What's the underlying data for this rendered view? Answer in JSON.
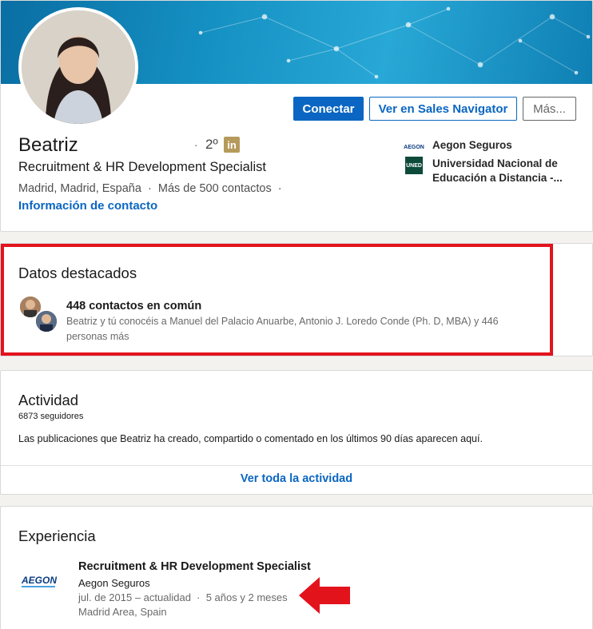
{
  "profile": {
    "name": "Beatriz",
    "separator": "·",
    "degree": "2º",
    "linkedin_badge": "in",
    "headline": "Recruitment & HR Development Specialist",
    "location_line": "Madrid, Madrid, España  ·  Más de 500 contactos  ·",
    "contact_info_link": "Información de contacto"
  },
  "actions": {
    "connect": "Conectar",
    "sales_navigator": "Ver en Sales Navigator",
    "more": "Más..."
  },
  "organizations": [
    {
      "name": "Aegon Seguros",
      "logo_text": "AEGON"
    },
    {
      "name": "Universidad Nacional de Educación a Distancia -...",
      "logo_text": "UNED"
    }
  ],
  "highlights": {
    "title": "Datos destacados",
    "mutual_title": "448 contactos en común",
    "mutual_desc": "Beatriz y tú conocéis a Manuel del Palacio Anuarbe, Antonio J. Loredo Conde (Ph. D, MBA) y 446 personas más"
  },
  "activity": {
    "title": "Actividad",
    "followers": "6873 seguidores",
    "description": "Las publicaciones que Beatriz ha creado, compartido o comentado en los últimos 90 días aparecen aquí.",
    "see_all": "Ver toda la actividad"
  },
  "experience": {
    "title": "Experiencia",
    "items": [
      {
        "role": "Recruitment & HR Development Specialist",
        "company": "Aegon Seguros",
        "dates": "jul. de 2015 – actualidad  ·  5 años y 2 meses",
        "location": "Madrid Area, Spain",
        "logo_text": "AEGON"
      }
    ]
  },
  "colors": {
    "accent": "#0a66c2",
    "annotation_red": "#e3131c",
    "badge_gold": "#b59a5b"
  }
}
